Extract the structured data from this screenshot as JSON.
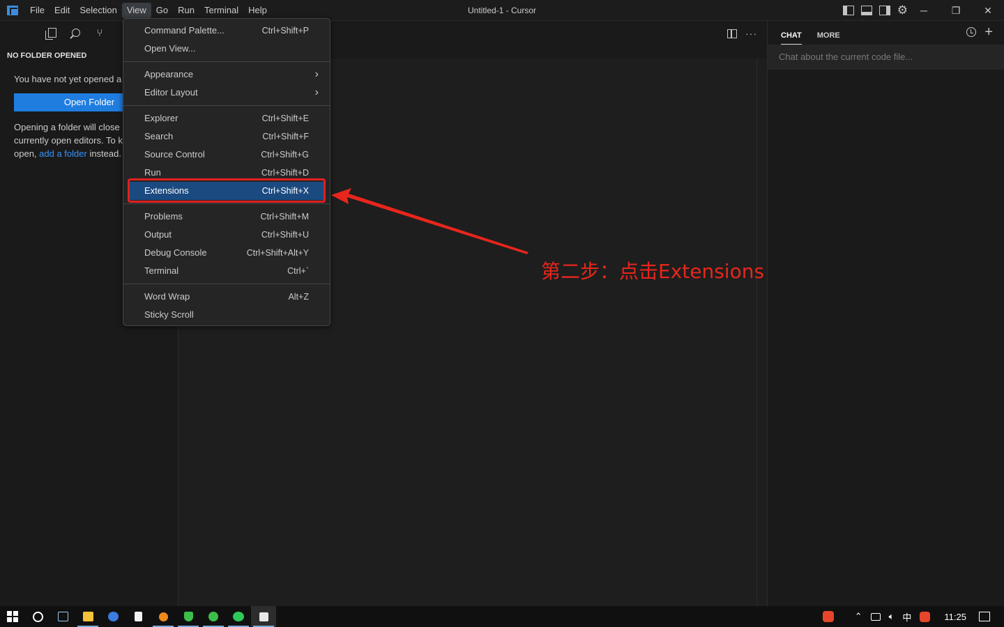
{
  "window": {
    "title": "Untitled-1 - Cursor",
    "minimize": "─",
    "restore": "❐",
    "close": "✕"
  },
  "menubar": {
    "items": [
      {
        "label": "File"
      },
      {
        "label": "Edit"
      },
      {
        "label": "Selection"
      },
      {
        "label": "View"
      },
      {
        "label": "Go"
      },
      {
        "label": "Run"
      },
      {
        "label": "Terminal"
      },
      {
        "label": "Help"
      }
    ],
    "active": "View"
  },
  "sidebar": {
    "title": "NO FOLDER OPENED",
    "message": "You have not yet opened a",
    "open_folder_label": "Open Folder",
    "info_line1": "Opening a folder will close",
    "info_line2": "currently open editors. To k",
    "info_line3_pre": "open, ",
    "info_link": "add a folder",
    "info_line3_post": " instead."
  },
  "chat": {
    "tabs": [
      {
        "label": "CHAT"
      },
      {
        "label": "MORE"
      }
    ],
    "placeholder": "Chat about the current code file..."
  },
  "view_menu": {
    "groups": [
      [
        {
          "label": "Command Palette...",
          "shortcut": "Ctrl+Shift+P"
        },
        {
          "label": "Open View...",
          "shortcut": ""
        }
      ],
      [
        {
          "label": "Appearance",
          "submenu": ">"
        },
        {
          "label": "Editor Layout",
          "submenu": ">"
        }
      ],
      [
        {
          "label": "Explorer",
          "shortcut": "Ctrl+Shift+E"
        },
        {
          "label": "Search",
          "shortcut": "Ctrl+Shift+F"
        },
        {
          "label": "Source Control",
          "shortcut": "Ctrl+Shift+G"
        },
        {
          "label": "Run",
          "shortcut": "Ctrl+Shift+D"
        },
        {
          "label": "Extensions",
          "shortcut": "Ctrl+Shift+X"
        }
      ],
      [
        {
          "label": "Problems",
          "shortcut": "Ctrl+Shift+M"
        },
        {
          "label": "Output",
          "shortcut": "Ctrl+Shift+U"
        },
        {
          "label": "Debug Console",
          "shortcut": "Ctrl+Shift+Alt+Y"
        },
        {
          "label": "Terminal",
          "shortcut": "Ctrl+`"
        }
      ],
      [
        {
          "label": "Word Wrap",
          "shortcut": "Alt+Z"
        },
        {
          "label": "Sticky Scroll",
          "shortcut": ""
        }
      ]
    ],
    "highlighted": "Extensions"
  },
  "annotation": {
    "text": "第二步：点击Extensions",
    "color": "#e8261c"
  },
  "taskbar": {
    "clock": "11:25",
    "ime": "中",
    "apps": [
      "file-explorer-icon",
      "browser-icon",
      "notepad-icon",
      "search-app-icon",
      "security-icon",
      "chat-app-icon",
      "wechat-icon",
      "cursor-icon"
    ]
  },
  "colors": {
    "accent": "#1f7de0",
    "highlight": "#1b4a80",
    "annotation_red": "#e02020"
  }
}
